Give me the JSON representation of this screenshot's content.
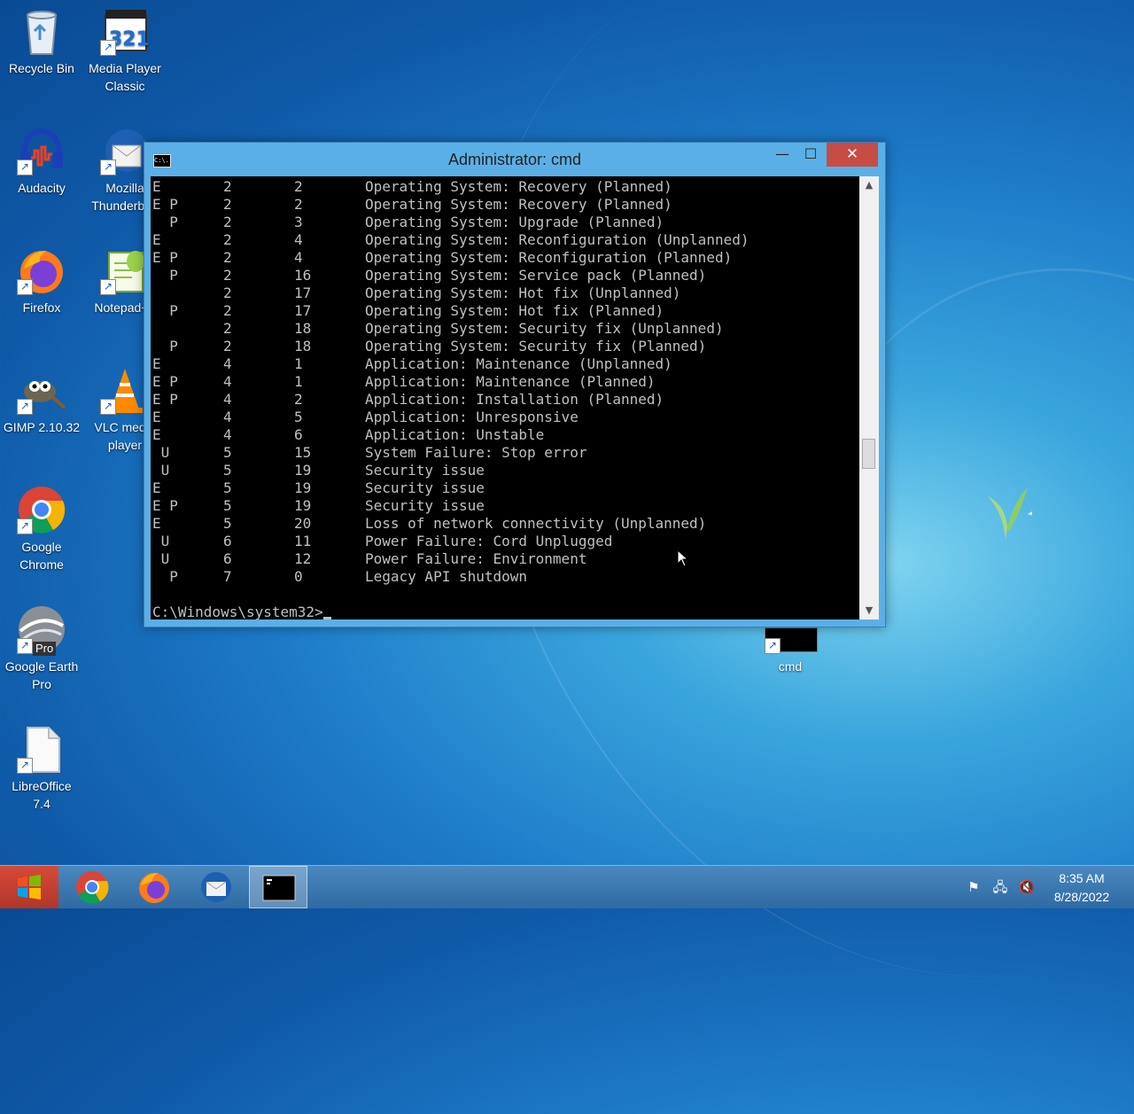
{
  "desktop": {
    "icons": [
      {
        "label": "Recycle Bin",
        "icon": "recycle-bin-icon"
      },
      {
        "label": "Media Player Classic",
        "icon": "media-player-classic-icon"
      },
      {
        "label": "Audacity",
        "icon": "audacity-icon"
      },
      {
        "label": "Mozilla Thunderbird",
        "icon": "thunderbird-icon"
      },
      {
        "label": "Firefox",
        "icon": "firefox-icon"
      },
      {
        "label": "Notepad++",
        "icon": "notepad-plus-plus-icon"
      },
      {
        "label": "GIMP 2.10.32",
        "icon": "gimp-icon"
      },
      {
        "label": "VLC media player",
        "icon": "vlc-icon"
      },
      {
        "label": "Google Chrome",
        "icon": "chrome-icon"
      },
      {
        "label": "Google Earth Pro",
        "icon": "google-earth-pro-icon"
      },
      {
        "label": "LibreOffice 7.4",
        "icon": "libreoffice-icon"
      },
      {
        "label": "cmd",
        "icon": "cmd-shortcut-icon"
      }
    ],
    "pro_badge": "Pro"
  },
  "window": {
    "title": "Administrator: cmd",
    "title_icon_text": "C:\\.",
    "controls": {
      "minimize": "—",
      "maximize": "☐",
      "close": "✕"
    },
    "rows": [
      {
        "flags": "E",
        "major": "2",
        "minor": "2",
        "reason": "Operating System: Recovery (Planned)"
      },
      {
        "flags": "E P",
        "major": "2",
        "minor": "2",
        "reason": "Operating System: Recovery (Planned)"
      },
      {
        "flags": "  P",
        "major": "2",
        "minor": "3",
        "reason": "Operating System: Upgrade (Planned)"
      },
      {
        "flags": "E",
        "major": "2",
        "minor": "4",
        "reason": "Operating System: Reconfiguration (Unplanned)"
      },
      {
        "flags": "E P",
        "major": "2",
        "minor": "4",
        "reason": "Operating System: Reconfiguration (Planned)"
      },
      {
        "flags": "  P",
        "major": "2",
        "minor": "16",
        "reason": "Operating System: Service pack (Planned)"
      },
      {
        "flags": "",
        "major": "2",
        "minor": "17",
        "reason": "Operating System: Hot fix (Unplanned)"
      },
      {
        "flags": "  P",
        "major": "2",
        "minor": "17",
        "reason": "Operating System: Hot fix (Planned)"
      },
      {
        "flags": "",
        "major": "2",
        "minor": "18",
        "reason": "Operating System: Security fix (Unplanned)"
      },
      {
        "flags": "  P",
        "major": "2",
        "minor": "18",
        "reason": "Operating System: Security fix (Planned)"
      },
      {
        "flags": "E",
        "major": "4",
        "minor": "1",
        "reason": "Application: Maintenance (Unplanned)"
      },
      {
        "flags": "E P",
        "major": "4",
        "minor": "1",
        "reason": "Application: Maintenance (Planned)"
      },
      {
        "flags": "E P",
        "major": "4",
        "minor": "2",
        "reason": "Application: Installation (Planned)"
      },
      {
        "flags": "E",
        "major": "4",
        "minor": "5",
        "reason": "Application: Unresponsive"
      },
      {
        "flags": "E",
        "major": "4",
        "minor": "6",
        "reason": "Application: Unstable"
      },
      {
        "flags": " U",
        "major": "5",
        "minor": "15",
        "reason": "System Failure: Stop error"
      },
      {
        "flags": " U",
        "major": "5",
        "minor": "19",
        "reason": "Security issue"
      },
      {
        "flags": "E",
        "major": "5",
        "minor": "19",
        "reason": "Security issue"
      },
      {
        "flags": "E P",
        "major": "5",
        "minor": "19",
        "reason": "Security issue"
      },
      {
        "flags": "E",
        "major": "5",
        "minor": "20",
        "reason": "Loss of network connectivity (Unplanned)"
      },
      {
        "flags": " U",
        "major": "6",
        "minor": "11",
        "reason": "Power Failure: Cord Unplugged"
      },
      {
        "flags": " U",
        "major": "6",
        "minor": "12",
        "reason": "Power Failure: Environment"
      },
      {
        "flags": "  P",
        "major": "7",
        "minor": "0",
        "reason": "Legacy API shutdown"
      }
    ],
    "prompt": "C:\\Windows\\system32>"
  },
  "taskbar": {
    "apps": [
      {
        "icon": "chrome-icon",
        "active": false
      },
      {
        "icon": "firefox-icon",
        "active": false
      },
      {
        "icon": "thunderbird-icon",
        "active": false
      },
      {
        "icon": "cmd-icon",
        "active": true
      }
    ],
    "tray": [
      "action-center-flag-icon",
      "network-icon",
      "volume-muted-icon"
    ],
    "time": "8:35 AM",
    "date": "8/28/2022"
  }
}
